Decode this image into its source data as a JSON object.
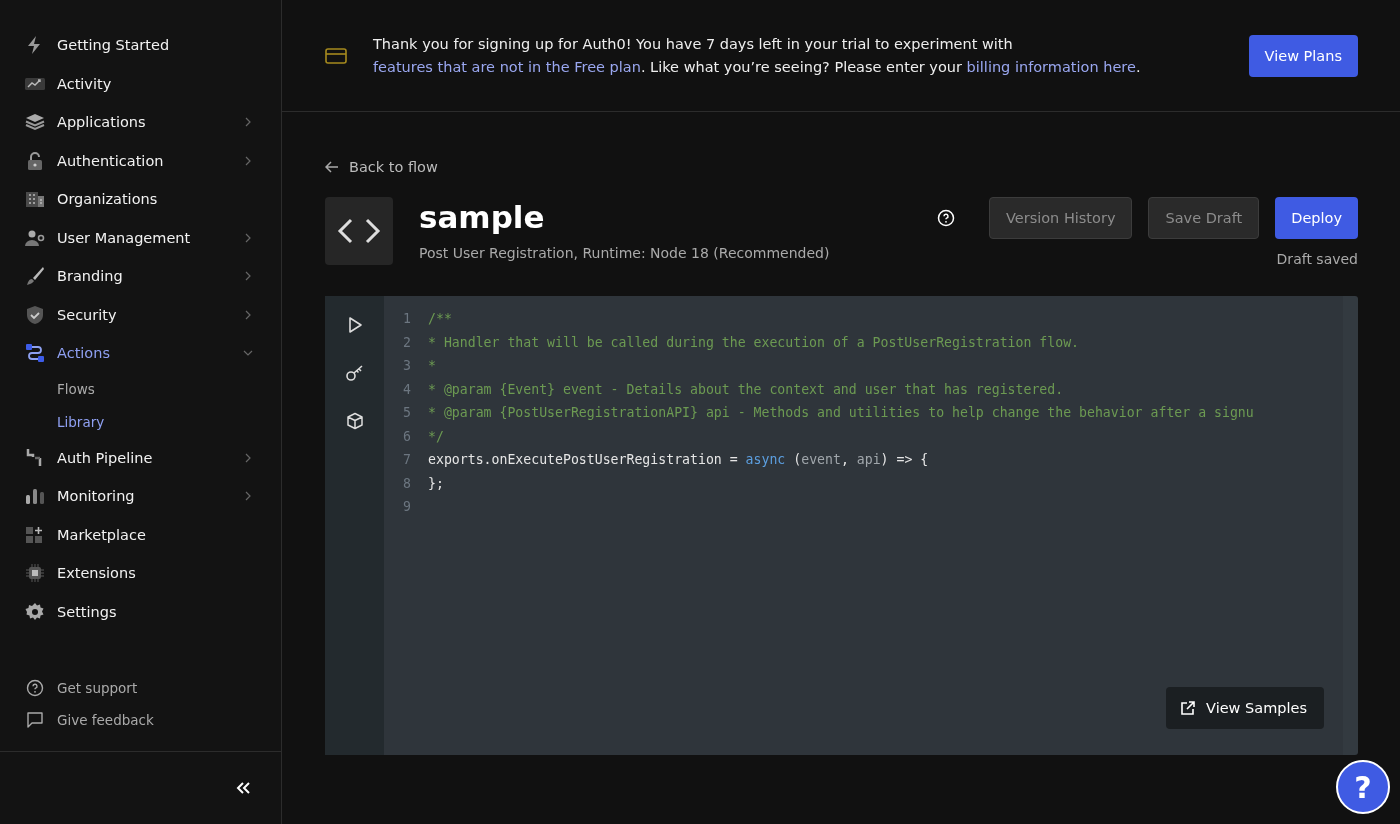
{
  "sidebar": {
    "items": [
      {
        "label": "Getting Started",
        "selected": false
      },
      {
        "label": "Activity",
        "selected": false
      },
      {
        "label": "Applications",
        "selected": false,
        "expanded": false
      },
      {
        "label": "Authentication",
        "selected": false,
        "expanded": false
      },
      {
        "label": "Organizations",
        "selected": false
      },
      {
        "label": "User Management",
        "selected": false,
        "expanded": false
      },
      {
        "label": "Branding",
        "selected": false,
        "expanded": false
      },
      {
        "label": "Security",
        "selected": false,
        "expanded": false
      },
      {
        "label": "Actions",
        "selected": true,
        "expanded": true,
        "children": [
          {
            "label": "Flows",
            "selected": false
          },
          {
            "label": "Library",
            "selected": true
          }
        ]
      },
      {
        "label": "Auth Pipeline",
        "selected": false,
        "expanded": false
      },
      {
        "label": "Monitoring",
        "selected": false,
        "expanded": false
      },
      {
        "label": "Marketplace",
        "selected": false
      },
      {
        "label": "Extensions",
        "selected": false
      },
      {
        "label": "Settings",
        "selected": false
      }
    ],
    "footer_links": [
      "Get support",
      "Give feedback"
    ]
  },
  "banner": {
    "parts": [
      {
        "text": "Thank you for signing up for Auth0! You have 7 days left in your trial to experiment with ",
        "link": false
      },
      {
        "text": "features that are not in the Free plan",
        "link": true
      },
      {
        "text": ". Like what you’re seeing? Please enter your ",
        "link": false
      },
      {
        "text": "billing information here",
        "link": true
      },
      {
        "text": ".",
        "link": false
      }
    ],
    "button": "View Plans"
  },
  "page": {
    "back_link": "Back to flow",
    "title": "sample",
    "subtitle": "Post User Registration, Runtime: Node 18 (Recommended)",
    "buttons": [
      {
        "label": "Version History",
        "kind": "secondary"
      },
      {
        "label": "Save Draft",
        "kind": "secondary"
      },
      {
        "label": "Deploy",
        "kind": "primary"
      }
    ],
    "status": "Draft saved"
  },
  "editor": {
    "lines": [
      {
        "number": "1",
        "tokens": [
          {
            "text": "/**",
            "kind": "comment"
          }
        ]
      },
      {
        "number": "2",
        "tokens": [
          {
            "text": "* Handler that will be called during the execution of a PostUserRegistration flow.",
            "kind": "comment"
          }
        ]
      },
      {
        "number": "3",
        "tokens": [
          {
            "text": "*",
            "kind": "comment"
          }
        ]
      },
      {
        "number": "4",
        "tokens": [
          {
            "text": "* @param {Event} event - Details about the context and user that has registered.",
            "kind": "comment"
          }
        ]
      },
      {
        "number": "5",
        "tokens": [
          {
            "text": "* @param {PostUserRegistrationAPI} api - Methods and utilities to help change the behavior after a signu",
            "kind": "comment"
          }
        ]
      },
      {
        "number": "6",
        "tokens": [
          {
            "text": "*/",
            "kind": "comment"
          }
        ]
      },
      {
        "number": "7",
        "tokens": [
          {
            "text": "exports.onExecutePostUserRegistration = ",
            "kind": "plain"
          },
          {
            "text": "async",
            "kind": "keyword"
          },
          {
            "text": " (",
            "kind": "plain"
          },
          {
            "text": "event",
            "kind": "param"
          },
          {
            "text": ", ",
            "kind": "plain"
          },
          {
            "text": "api",
            "kind": "param"
          },
          {
            "text": ") => {",
            "kind": "plain"
          }
        ]
      },
      {
        "number": "8",
        "tokens": [
          {
            "text": "};",
            "kind": "plain"
          }
        ]
      },
      {
        "number": "9"
      }
    ],
    "samples_button": "View Samples"
  },
  "help_button": "?"
}
